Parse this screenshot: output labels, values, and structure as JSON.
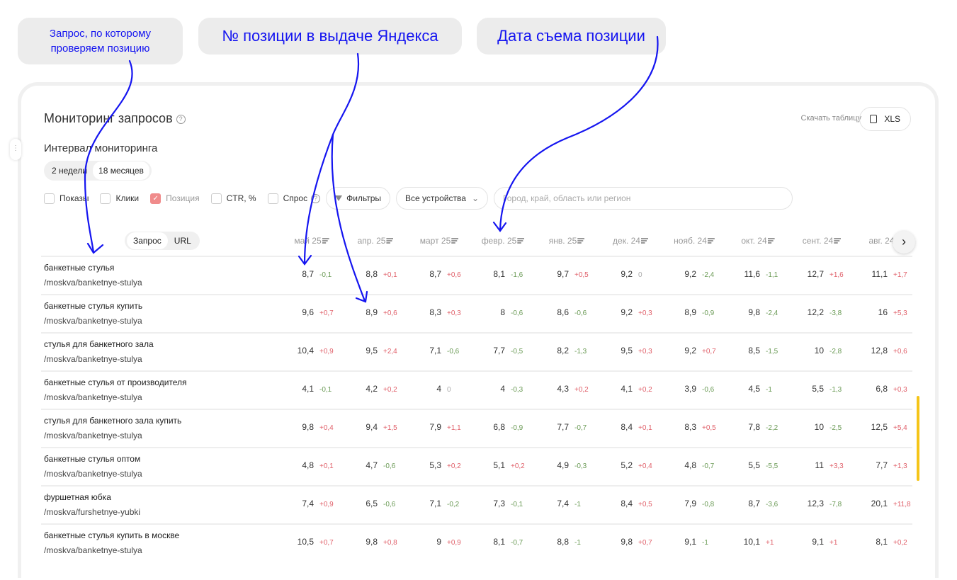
{
  "annotations": [
    {
      "text": "Запрос, по которому проверяем позицию",
      "line1": "Запрос, по которому",
      "line2": "проверяем позицию"
    },
    {
      "text": "№ позиции в выдаче Яндекса"
    },
    {
      "text": "Дата съема позиции"
    }
  ],
  "colors": {
    "annotation": "#1515f0",
    "positive_delta": "#e0606a",
    "negative_delta": "#6a9a55",
    "accent_check": "#f08b8b"
  },
  "header": {
    "title": "Мониторинг запросов",
    "download_label": "Скачать таблицу",
    "xls_label": "XLS"
  },
  "interval": {
    "label": "Интервал мониторинга",
    "options": [
      "2 недели",
      "18 месяцев"
    ],
    "selected": "18 месяцев"
  },
  "metrics": [
    {
      "label": "Показы",
      "checked": false
    },
    {
      "label": "Клики",
      "checked": false
    },
    {
      "label": "Позиция",
      "checked": true
    },
    {
      "label": "CTR, %",
      "checked": false
    },
    {
      "label": "Спрос",
      "checked": false
    }
  ],
  "filters_label": "Фильтры",
  "devices_select": "Все устройства",
  "region_placeholder": "Город, край, область или регион",
  "view_toggle": {
    "options": [
      "Запрос",
      "URL"
    ],
    "selected": "Запрос"
  },
  "columns": [
    "май 25",
    "апр. 25",
    "март 25",
    "февр. 25",
    "янв. 25",
    "дек. 24",
    "нояб. 24",
    "окт. 24",
    "сент. 24",
    "авг. 24"
  ],
  "rows": [
    {
      "query": "банкетные стулья",
      "url": "/moskva/banketnye-stulya",
      "cells": [
        [
          "8,7",
          "-0,1"
        ],
        [
          "8,8",
          "+0,1"
        ],
        [
          "8,7",
          "+0,6"
        ],
        [
          "8,1",
          "-1,6"
        ],
        [
          "9,7",
          "+0,5"
        ],
        [
          "9,2",
          "0"
        ],
        [
          "9,2",
          "-2,4"
        ],
        [
          "11,6",
          "-1,1"
        ],
        [
          "12,7",
          "+1,6"
        ],
        [
          "11,1",
          "+1,7"
        ]
      ]
    },
    {
      "query": "банкетные стулья купить",
      "url": "/moskva/banketnye-stulya",
      "cells": [
        [
          "9,6",
          "+0,7"
        ],
        [
          "8,9",
          "+0,6"
        ],
        [
          "8,3",
          "+0,3"
        ],
        [
          "8",
          "-0,6"
        ],
        [
          "8,6",
          "-0,6"
        ],
        [
          "9,2",
          "+0,3"
        ],
        [
          "8,9",
          "-0,9"
        ],
        [
          "9,8",
          "-2,4"
        ],
        [
          "12,2",
          "-3,8"
        ],
        [
          "16",
          "+5,3"
        ]
      ]
    },
    {
      "query": "стулья для банкетного зала",
      "url": "/moskva/banketnye-stulya",
      "cells": [
        [
          "10,4",
          "+0,9"
        ],
        [
          "9,5",
          "+2,4"
        ],
        [
          "7,1",
          "-0,6"
        ],
        [
          "7,7",
          "-0,5"
        ],
        [
          "8,2",
          "-1,3"
        ],
        [
          "9,5",
          "+0,3"
        ],
        [
          "9,2",
          "+0,7"
        ],
        [
          "8,5",
          "-1,5"
        ],
        [
          "10",
          "-2,8"
        ],
        [
          "12,8",
          "+0,6"
        ]
      ]
    },
    {
      "query": "банкетные стулья от производителя",
      "url": "/moskva/banketnye-stulya",
      "cells": [
        [
          "4,1",
          "-0,1"
        ],
        [
          "4,2",
          "+0,2"
        ],
        [
          "4",
          "0"
        ],
        [
          "4",
          "-0,3"
        ],
        [
          "4,3",
          "+0,2"
        ],
        [
          "4,1",
          "+0,2"
        ],
        [
          "3,9",
          "-0,6"
        ],
        [
          "4,5",
          "-1"
        ],
        [
          "5,5",
          "-1,3"
        ],
        [
          "6,8",
          "+0,3"
        ]
      ]
    },
    {
      "query": "стулья для банкетного зала купить",
      "url": "/moskva/banketnye-stulya",
      "cells": [
        [
          "9,8",
          "+0,4"
        ],
        [
          "9,4",
          "+1,5"
        ],
        [
          "7,9",
          "+1,1"
        ],
        [
          "6,8",
          "-0,9"
        ],
        [
          "7,7",
          "-0,7"
        ],
        [
          "8,4",
          "+0,1"
        ],
        [
          "8,3",
          "+0,5"
        ],
        [
          "7,8",
          "-2,2"
        ],
        [
          "10",
          "-2,5"
        ],
        [
          "12,5",
          "+5,4"
        ]
      ]
    },
    {
      "query": "банкетные стулья оптом",
      "url": "/moskva/banketnye-stulya",
      "cells": [
        [
          "4,8",
          "+0,1"
        ],
        [
          "4,7",
          "-0,6"
        ],
        [
          "5,3",
          "+0,2"
        ],
        [
          "5,1",
          "+0,2"
        ],
        [
          "4,9",
          "-0,3"
        ],
        [
          "5,2",
          "+0,4"
        ],
        [
          "4,8",
          "-0,7"
        ],
        [
          "5,5",
          "-5,5"
        ],
        [
          "11",
          "+3,3"
        ],
        [
          "7,7",
          "+1,3"
        ]
      ]
    },
    {
      "query": "фуршетная юбка",
      "url": "/moskva/furshetnye-yubki",
      "cells": [
        [
          "7,4",
          "+0,9"
        ],
        [
          "6,5",
          "-0,6"
        ],
        [
          "7,1",
          "-0,2"
        ],
        [
          "7,3",
          "-0,1"
        ],
        [
          "7,4",
          "-1"
        ],
        [
          "8,4",
          "+0,5"
        ],
        [
          "7,9",
          "-0,8"
        ],
        [
          "8,7",
          "-3,6"
        ],
        [
          "12,3",
          "-7,8"
        ],
        [
          "20,1",
          "+11,8"
        ]
      ]
    },
    {
      "query": "банкетные стулья купить в москве",
      "url": "/moskva/banketnye-stulya",
      "cells": [
        [
          "10,5",
          "+0,7"
        ],
        [
          "9,8",
          "+0,8"
        ],
        [
          "9",
          "+0,9"
        ],
        [
          "8,1",
          "-0,7"
        ],
        [
          "8,8",
          "-1"
        ],
        [
          "9,8",
          "+0,7"
        ],
        [
          "9,1",
          "-1"
        ],
        [
          "10,1",
          "+1"
        ],
        [
          "9,1",
          "+1"
        ],
        [
          "8,1",
          "+0,2"
        ]
      ]
    }
  ]
}
